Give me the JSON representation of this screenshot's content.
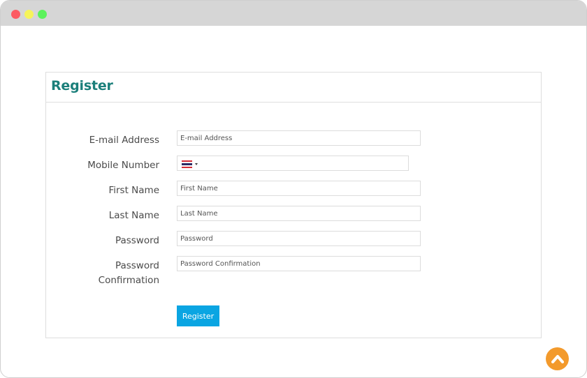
{
  "form": {
    "title": "Register",
    "fields": {
      "email": {
        "label": "E-mail Address",
        "placeholder": "E-mail Address",
        "value": ""
      },
      "mobile": {
        "label": "Mobile Number",
        "value": "",
        "country": "Thailand"
      },
      "first_name": {
        "label": "First Name",
        "placeholder": "First Name",
        "value": ""
      },
      "last_name": {
        "label": "Last Name",
        "placeholder": "Last Name",
        "value": ""
      },
      "password": {
        "label": "Password",
        "placeholder": "Password",
        "value": ""
      },
      "password_confirmation": {
        "label_line1": "Password",
        "label_line2": "Confirmation",
        "placeholder": "Password Confirmation",
        "value": ""
      }
    },
    "submit_label": "Register"
  },
  "icons": {
    "scroll_top": "chevron-up-icon",
    "flag": "thailand-flag-icon"
  },
  "colors": {
    "title": "#1b7f7a",
    "button": "#0aa5e2",
    "scroll_top": "#f39a2c",
    "titlebar": "#d6d6d6",
    "close_dot": "#fc5b63",
    "minimize_dot": "#f6f45a",
    "maximize_dot": "#5cf25c"
  }
}
